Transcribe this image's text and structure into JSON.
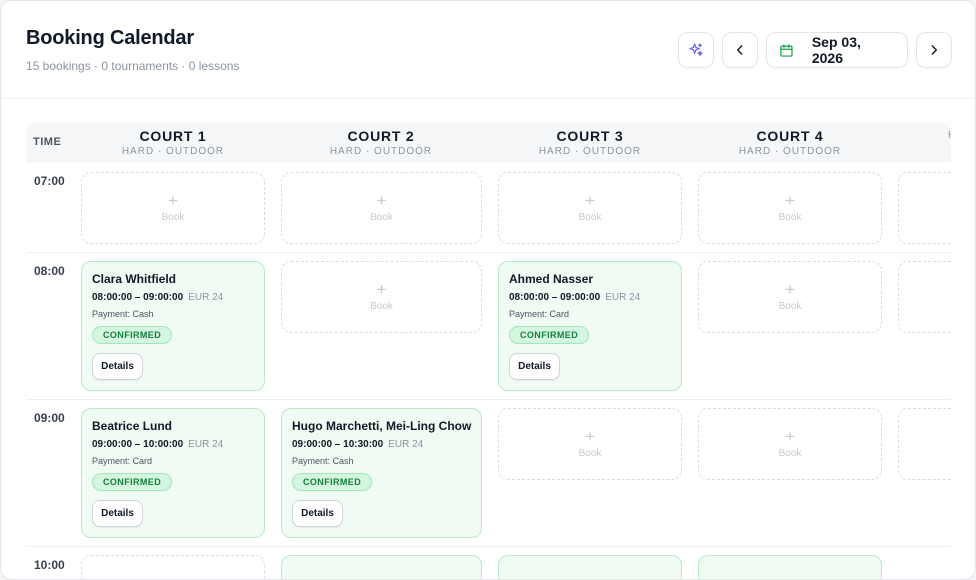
{
  "header": {
    "title": "Booking Calendar",
    "subtitle": "15 bookings · 0 tournaments · 0 lessons",
    "date": "Sep 03, 2026"
  },
  "grid": {
    "time_header": "TIME",
    "courts": [
      {
        "name": "COURT 1",
        "sub": "HARD · OUTDOOR"
      },
      {
        "name": "COURT 2",
        "sub": "HARD · OUTDOOR"
      },
      {
        "name": "COURT 3",
        "sub": "HARD · OUTDOOR"
      },
      {
        "name": "COURT 4",
        "sub": "HARD · OUTDOOR"
      },
      {
        "name": "",
        "sub": "H"
      }
    ],
    "times": [
      "07:00",
      "08:00",
      "09:00",
      "10:00"
    ],
    "book_label": "Book",
    "plus": "+"
  },
  "bookings": [
    {
      "name": "Clara Whitfield",
      "time": "08:00:00 – 09:00:00",
      "price": "EUR 24",
      "payment": "Payment: Cash",
      "status": "CONFIRMED",
      "details": "Details"
    },
    {
      "name": "Ahmed Nasser",
      "time": "08:00:00 – 09:00:00",
      "price": "EUR 24",
      "payment": "Payment: Card",
      "status": "CONFIRMED",
      "details": "Details"
    },
    {
      "name": "Beatrice Lund",
      "time": "09:00:00 – 10:00:00",
      "price": "EUR 24",
      "payment": "Payment: Card",
      "status": "CONFIRMED",
      "details": "Details"
    },
    {
      "name": "Hugo Marchetti, Mei-Ling Chow",
      "time": "09:00:00 – 10:30:00",
      "price": "EUR 24",
      "payment": "Payment: Cash",
      "status": "CONFIRMED",
      "details": "Details"
    }
  ],
  "colors": {
    "accent": "#6366f1",
    "calendar_icon": "#16a34a",
    "confirmed_bg": "#effbf3",
    "confirmed_border": "#b7ebc8",
    "confirmed_text": "#15803d"
  },
  "icons": {
    "sparkle": "sparkle-icon",
    "prev": "chevron-left-icon",
    "next": "chevron-right-icon",
    "calendar": "calendar-icon"
  }
}
